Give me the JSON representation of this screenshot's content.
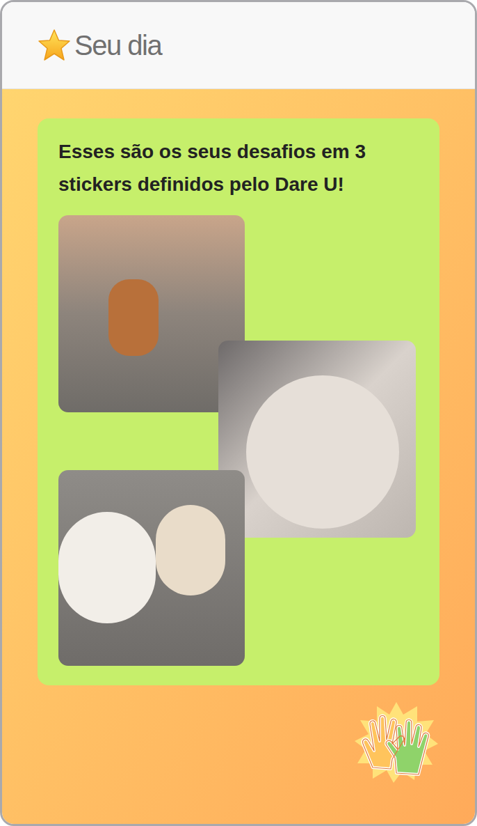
{
  "header": {
    "title": "Seu dia"
  },
  "card": {
    "title": "Esses são os seus desafios em 3 stickers definidos pelo Dare U!"
  }
}
